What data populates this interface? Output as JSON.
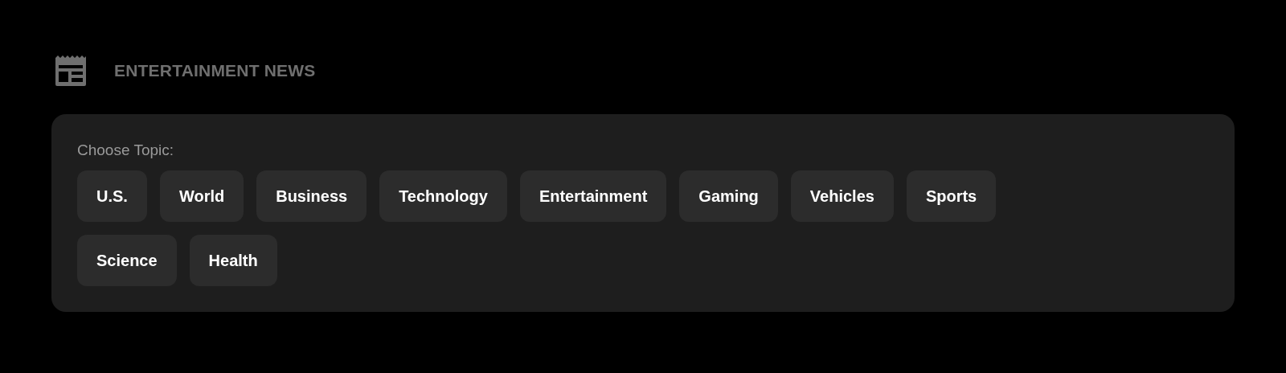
{
  "header": {
    "title": "ENTERTAINMENT NEWS"
  },
  "topic_picker": {
    "label": "Choose Topic:",
    "topics": [
      {
        "label": "U.S."
      },
      {
        "label": "World"
      },
      {
        "label": "Business"
      },
      {
        "label": "Technology"
      },
      {
        "label": "Entertainment"
      },
      {
        "label": "Gaming"
      },
      {
        "label": "Vehicles"
      },
      {
        "label": "Sports"
      },
      {
        "label": "Science"
      },
      {
        "label": "Health"
      }
    ]
  }
}
